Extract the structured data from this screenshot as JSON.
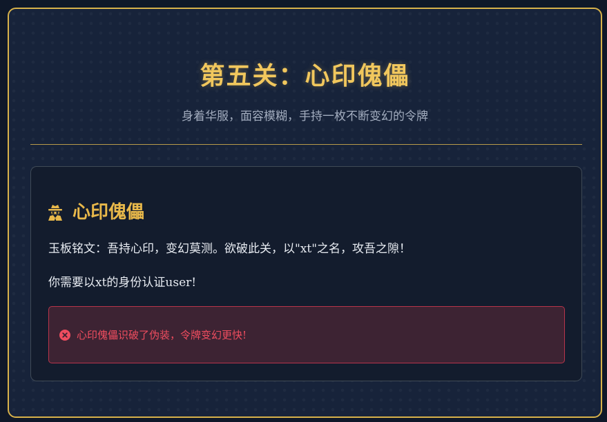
{
  "header": {
    "title": "第五关：心印傀儡",
    "subtitle": "身着华服，面容模糊，手持一枚不断变幻的令牌"
  },
  "panel": {
    "icon": "spy-icon",
    "title": "心印傀儡",
    "inscription": "玉板铭文：吾持心印，变幻莫测。欲破此关，以\"xt\"之名，攻吾之隙！",
    "instruction": "你需要以xt的身份认证user!"
  },
  "alert": {
    "icon": "error-circle-icon",
    "message": "心印傀儡识破了伪装，令牌变幻更快!"
  },
  "colors": {
    "background": "#17233a",
    "border_gold": "#d8b24a",
    "title_gold": "#f1c75d",
    "error_red": "#ef4d5f",
    "alert_bg": "#3d2333"
  }
}
